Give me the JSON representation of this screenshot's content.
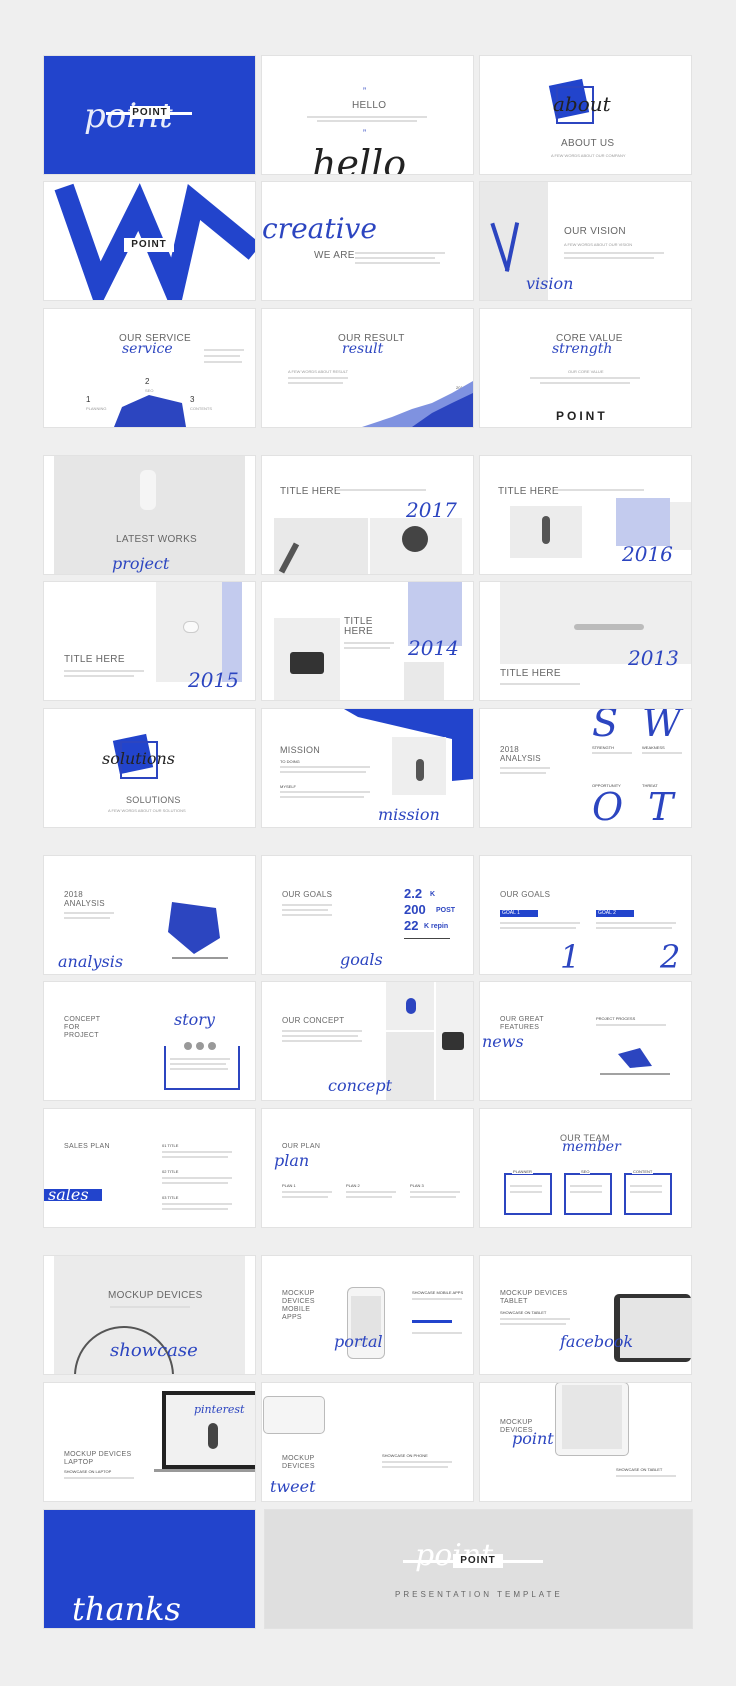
{
  "colors": {
    "accent": "#2244cc",
    "background": "#efefef",
    "slide": "#ffffff"
  },
  "slides": {
    "s1": {
      "brand": "POINT",
      "script": "point"
    },
    "s2": {
      "quote": "”",
      "title": "HELLO",
      "quote2": "”",
      "script": "hello"
    },
    "s3": {
      "script": "about",
      "title": "ABOUT US",
      "sub": "A FEW WORDS ABOUT OUR COMPANY"
    },
    "s4": {
      "brand": "POINT"
    },
    "s5": {
      "script": "creative",
      "title": "WE ARE"
    },
    "s6": {
      "title": "OUR VISION",
      "sub": "A FEW WORDS ABOUT OUR VISION",
      "script": "vision"
    },
    "s7": {
      "title": "OUR SERVICE",
      "script": "service",
      "n1": "1",
      "l1": "PLANNING",
      "n2": "2",
      "l2": "SEO",
      "n3": "3",
      "l3": "CONTENTS"
    },
    "s8": {
      "title": "OUR RESULT",
      "script": "result",
      "sub": "A FEW WORDS ABOUT RESULT",
      "year": "2017"
    },
    "s9": {
      "title": "CORE VALUE",
      "script": "strength",
      "sub": "OUR CORE VALUE",
      "brand": "POINT"
    },
    "s10": {
      "title": "LATEST WORKS",
      "script": "project"
    },
    "s11": {
      "title": "TITLE HERE",
      "year": "2017"
    },
    "s12": {
      "title": "TITLE HERE",
      "year": "2016"
    },
    "s13": {
      "title": "TITLE HERE",
      "year": "2015"
    },
    "s14": {
      "title1": "TITLE",
      "title2": "HERE",
      "year": "2014"
    },
    "s15": {
      "title": "TITLE HERE",
      "year": "2013"
    },
    "s16": {
      "script": "solutions",
      "title": "SOLUTIONS",
      "sub": "A FEW WORDS ABOUT OUR SOLUTIONS"
    },
    "s17": {
      "title": "MISSION",
      "h1": "TO DOING",
      "h2": "MYSELF",
      "script": "mission"
    },
    "s18": {
      "title1": "2018",
      "title2": "ANALYSIS",
      "s": "S",
      "w": "W",
      "o": "O",
      "tt": "T",
      "l1": "STRENGTH",
      "l2": "WEAKNESS",
      "l3": "OPPORTUNITY",
      "l4": "THREAT"
    },
    "s19": {
      "title1": "2018",
      "title2": "ANALYSIS",
      "script": "analysis"
    },
    "s20": {
      "title": "OUR GOALS",
      "v1": "2.2",
      "u1": "K",
      "v2": "200",
      "u2": "POST",
      "v3": "22",
      "u3": "K repin",
      "script": "goals"
    },
    "s21": {
      "title": "OUR GOALS",
      "g1": "GOAL 1",
      "g2": "GOAL 2",
      "n1": "1",
      "n2": "2"
    },
    "s22": {
      "t1": "CONCEPT",
      "t2": "FOR",
      "t3": "PROJECT",
      "script": "story"
    },
    "s23": {
      "title": "OUR CONCEPT",
      "script": "concept"
    },
    "s24": {
      "t1": "OUR GREAT",
      "t2": "FEATURES",
      "script": "news",
      "sub": "PROJECT PROCESS"
    },
    "s25": {
      "title": "SALES PLAN",
      "script": "sales",
      "i1": "01 TITLE",
      "i2": "02 TITLE",
      "i3": "03 TITLE"
    },
    "s26": {
      "title": "OUR PLAN",
      "script": "plan",
      "p1": "PLAN 1",
      "p2": "PLAN 2",
      "p3": "PLAN 3"
    },
    "s27": {
      "title": "OUR TEAM",
      "script": "member",
      "m1": "PLANNER",
      "m2": "SEO",
      "m3": "CONTENT"
    },
    "s28": {
      "title": "MOCKUP DEVICES",
      "script": "showcase"
    },
    "s29": {
      "t1": "MOCKUP",
      "t2": "DEVICES",
      "t3": "MOBILE",
      "t4": "APPS",
      "script": "portal",
      "sub": "SHOWCASE MOBILE APPS"
    },
    "s30": {
      "t1": "MOCKUP DEVICES",
      "t2": "TABLET",
      "sub": "SHOWCASE ON TABLET",
      "script": "facebook"
    },
    "s31": {
      "t1": "MOCKUP DEVICES",
      "t2": "LAPTOP",
      "sub": "SHOWCASE ON LAPTOP",
      "screen": "pinterest"
    },
    "s32": {
      "t1": "MOCKUP",
      "t2": "DEVICES",
      "script": "tweet",
      "sub": "SHOWCASE ON PHONE"
    },
    "s33": {
      "t1": "MOCKUP",
      "t2": "DEVICES",
      "script": "point",
      "sub": "SHOWCASE ON TABLET"
    },
    "s34": {
      "script": "thanks"
    },
    "s35": {
      "brand": "POINT",
      "sub": "PRESENTATION TEMPLATE",
      "script": "point"
    }
  }
}
